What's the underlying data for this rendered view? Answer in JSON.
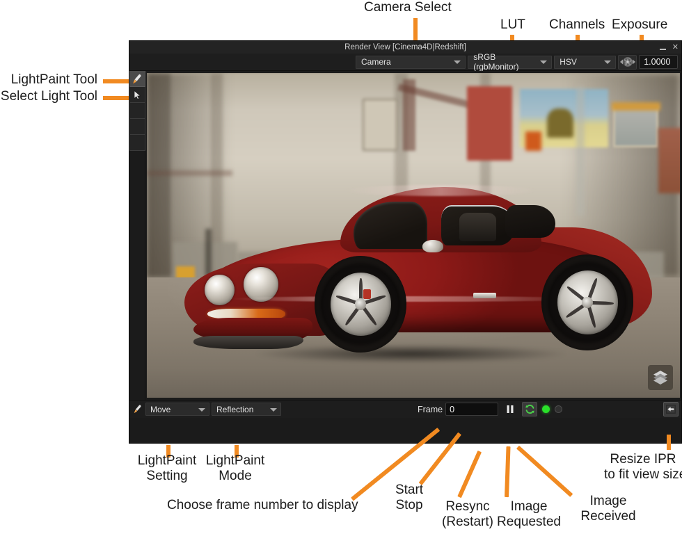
{
  "window": {
    "title": "Render View [Cinema4D|Redshift]",
    "minimize_label": "—",
    "close_label": "✕"
  },
  "toolbar": {
    "camera_select": "Camera",
    "lut": "sRGB (rgbMonitor)",
    "channels": "HSV",
    "exposure": "1.0000",
    "iris_icon": "aperture-icon"
  },
  "tools": [
    {
      "name": "lightpaint-tool",
      "icon": "paintbrush-icon",
      "active": true
    },
    {
      "name": "select-light-tool",
      "icon": "cursor-arrow-icon",
      "active": false
    },
    {
      "name": "tool-slot-3",
      "icon": "",
      "active": false
    },
    {
      "name": "tool-slot-4",
      "icon": "",
      "active": false
    },
    {
      "name": "tool-slot-5",
      "icon": "",
      "active": false
    }
  ],
  "statusbar": {
    "lightpaint_icon": "paintbrush-icon",
    "lightpaint_setting": "Move",
    "lightpaint_mode": "Reflection",
    "frame_label": "Frame",
    "frame_value": "0",
    "start_stop_icon": "pause-icon",
    "resync_icon": "refresh-icon",
    "image_requested_state": "on",
    "image_received_state": "off",
    "resize_icon": "arrow-left-into-box-icon"
  },
  "render": {
    "badge": "redshift-logo-badge",
    "subject": "red Porsche 911 coupe in a blurred industrial warehouse interior"
  },
  "annotations": {
    "camera_select": "Camera Select",
    "lut": "LUT",
    "channels": "Channels",
    "exposure": "Exposure",
    "lightpaint_tool": "LightPaint Tool",
    "select_light_tool": "Select Light Tool",
    "lightpaint_setting": "LightPaint\nSetting",
    "lightpaint_mode": "LightPaint\nMode",
    "choose_frame": "Choose frame number to display",
    "start_stop": "Start\nStop",
    "resync": "Resync\n(Restart)",
    "image_requested": "Image\nRequested",
    "image_received": "Image\nReceived",
    "resize_ipr": "Resize IPR\nto fit view size"
  },
  "colors": {
    "accent": "#f18a21",
    "panel": "#1e1e1e",
    "text": "#e2e2e2",
    "led_on": "#2ae02a"
  }
}
